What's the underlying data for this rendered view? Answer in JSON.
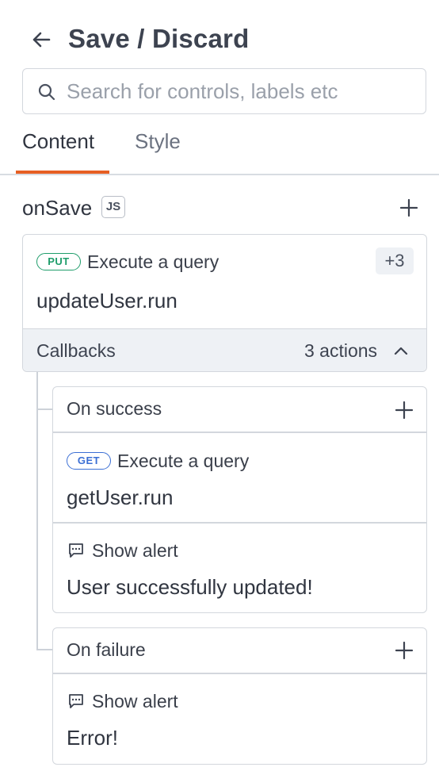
{
  "header": {
    "title": "Save / Discard",
    "back_icon": "arrow-left-icon"
  },
  "search": {
    "placeholder": "Search for controls, labels etc",
    "value": ""
  },
  "tabs": [
    {
      "label": "Content",
      "active": true
    },
    {
      "label": "Style",
      "active": false
    }
  ],
  "event": {
    "name": "onSave",
    "badge": "JS",
    "action": {
      "method": "PUT",
      "label": "Execute a query",
      "value": "updateUser.run",
      "extra_count": "+3"
    },
    "callbacks": {
      "label": "Callbacks",
      "count_label": "3 actions",
      "expanded": true,
      "on_success": {
        "label": "On success",
        "actions": [
          {
            "method": "GET",
            "label": "Execute a query",
            "value": "getUser.run"
          },
          {
            "icon": "message-icon",
            "label": "Show alert",
            "value": "User successfully updated!"
          }
        ]
      },
      "on_failure": {
        "label": "On failure",
        "actions": [
          {
            "icon": "message-icon",
            "label": "Show alert",
            "value": "Error!"
          }
        ]
      }
    }
  },
  "colors": {
    "accent": "#e65f23",
    "put": "#1f9d6b",
    "get": "#3b6fd4",
    "callbacks_bg": "#eef1f5"
  }
}
